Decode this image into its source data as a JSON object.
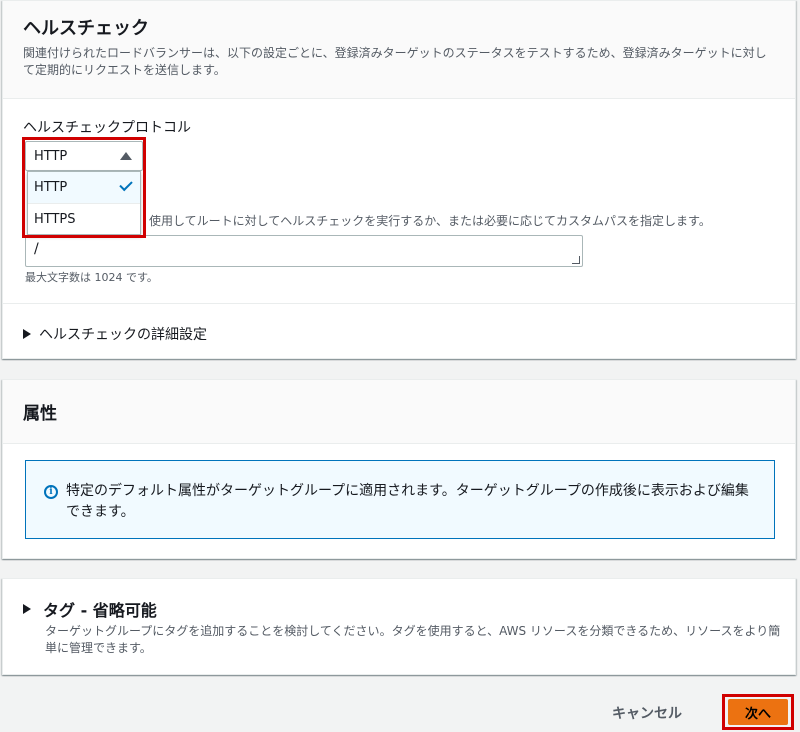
{
  "health_check": {
    "title": "ヘルスチェック",
    "description": "関連付けられたロードバランサーは、以下の設定ごとに、登録済みターゲットのステータスをテストするため、登録済みターゲットに対して定期的にリクエストを送信します。",
    "protocol_label": "ヘルスチェックプロトコル",
    "protocol_value": "HTTP",
    "protocol_options": [
      {
        "label": "HTTP",
        "selected": true
      },
      {
        "label": "HTTPS",
        "selected": false
      }
    ],
    "path_hint": "使用してルートに対してヘルスチェックを実行するか、または必要に応じてカスタムパスを指定します。",
    "path_value": "/",
    "path_note": "最大文字数は 1024 です。",
    "advanced_label": "ヘルスチェックの詳細設定"
  },
  "attributes": {
    "title": "属性",
    "info_text": "特定のデフォルト属性がターゲットグループに適用されます。ターゲットグループの作成後に表示および編集できます。"
  },
  "tags": {
    "title": "タグ - 省略可能",
    "description": "ターゲットグループにタグを追加することを検討してください。タグを使用すると、AWS リソースを分類できるため、リソースをより簡単に管理できます。"
  },
  "footer": {
    "cancel_label": "キャンセル",
    "next_label": "次へ"
  },
  "colors": {
    "highlight": "#d00000",
    "primary_button": "#ec7211",
    "info_border": "#0073bb"
  }
}
